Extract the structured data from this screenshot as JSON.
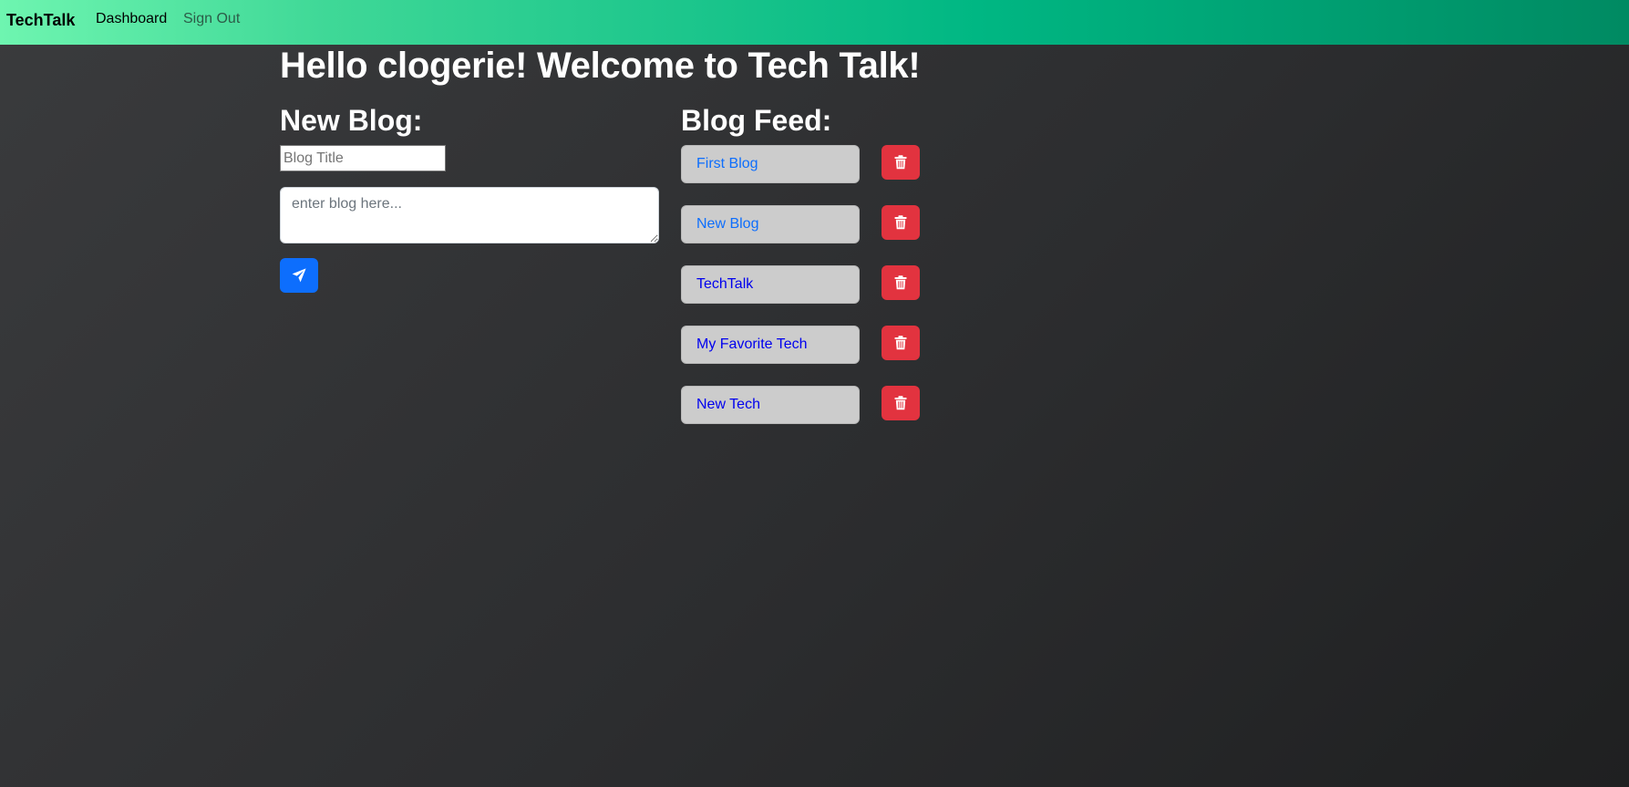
{
  "navbar": {
    "brand": "TechTalk",
    "links": [
      "Dashboard",
      "Sign Out"
    ],
    "gradient": [
      "#6ef5b0",
      "#00b783",
      "#008a62"
    ]
  },
  "welcome": "Hello clogerie! Welcome to Tech Talk!",
  "new_blog": {
    "heading": "New Blog:",
    "title_placeholder": "Blog Title",
    "title_value": "",
    "body_placeholder": "enter blog here...",
    "body_value": "",
    "submit_icon": "send-icon"
  },
  "feed": {
    "heading": "Blog Feed:",
    "items": [
      {
        "title": "First Blog",
        "color": "#0d6efd"
      },
      {
        "title": "New Blog",
        "color": "#0d6efd"
      },
      {
        "title": "TechTalk",
        "color": "#0000ee"
      },
      {
        "title": "My Favorite Tech",
        "color": "#0000ee"
      },
      {
        "title": "New Tech",
        "color": "#0000ee"
      }
    ],
    "delete_icon": "trash-icon"
  },
  "colors": {
    "primary": "#0d6efd",
    "danger": "#e2333f",
    "feed_item_bg": "#cccccc"
  }
}
